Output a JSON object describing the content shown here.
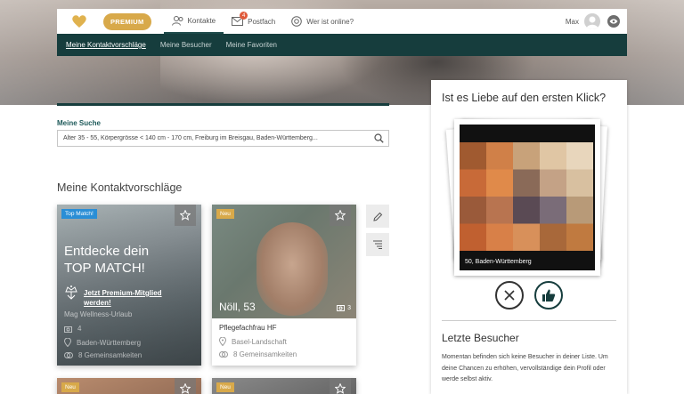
{
  "nav": {
    "premium": "PREMIUM",
    "items": [
      {
        "label": "Kontakte",
        "icon": "contacts-icon"
      },
      {
        "label": "Postfach",
        "icon": "mail-icon",
        "badge": "4"
      },
      {
        "label": "Wer ist online?",
        "icon": "online-icon"
      }
    ],
    "user": "Max"
  },
  "subnav": {
    "items": [
      "Meine Kontaktvorschläge",
      "Meine Besucher",
      "Meine Favoriten"
    ]
  },
  "search": {
    "label": "Meine Suche",
    "value": "Alter 35 - 55, Körpergrösse < 140 cm - 170 cm, Freiburg im Breisgau, Baden-Württemberg..."
  },
  "section": {
    "title": "Meine Kontaktvorschläge"
  },
  "cards": {
    "top": {
      "tag": "Top Match!",
      "title_line1": "Entdecke dein",
      "title_line2": "TOP MATCH!",
      "premium_link_line1": "Jetzt Premium-Mitglied",
      "premium_link_line2": "werden!",
      "meta1": "Mag Wellness-Urlaub",
      "meta2": "4",
      "meta3": "Baden-Württemberg",
      "meta4": "8 Gemeinsamkeiten"
    },
    "profile": {
      "tag": "Neu",
      "name": "Nöll, 53",
      "photos": "3",
      "job": "Pflegefachfrau HF",
      "location": "Basel-Landschaft",
      "common": "8 Gemeinsamkeiten"
    },
    "next1": {
      "tag": "Neu"
    },
    "next2": {
      "tag": "Neu"
    }
  },
  "right_panel": {
    "title": "Ist es Liebe auf den ersten Klick?",
    "caption": "50, Baden-Württemberg",
    "visitors_title": "Letzte Besucher",
    "visitors_text_1": "Momentan befinden sich keine Besucher in deiner Liste. Um",
    "visitors_text_2": "deine Chancen zu erhöhen, vervollständige dein Profil oder",
    "visitors_text_3": "werde selbst aktiv."
  },
  "colors": {
    "teal": "#163d3d",
    "gold": "#d8a94a",
    "blue": "#2a8ed6"
  }
}
